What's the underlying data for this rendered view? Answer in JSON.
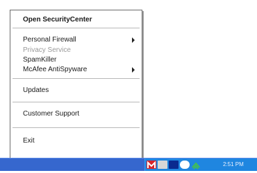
{
  "menu": {
    "items": [
      {
        "label": "Open SecurityCenter",
        "bold": true
      },
      {
        "label": "Personal Firewall",
        "submenu": true
      },
      {
        "label": "Privacy Service",
        "disabled": true
      },
      {
        "label": "SpamKiller"
      },
      {
        "label": "McAfee AntiSpyware",
        "submenu": true
      },
      {
        "label": "Updates"
      },
      {
        "label": "Customer Support"
      },
      {
        "label": "Exit"
      }
    ]
  },
  "taskbar": {
    "tray_icons": [
      "mcafee-m-icon",
      "security-icon",
      "network-icon",
      "shield-globe-icon",
      "green-arrow-icon"
    ],
    "clock": "2:51 PM"
  }
}
